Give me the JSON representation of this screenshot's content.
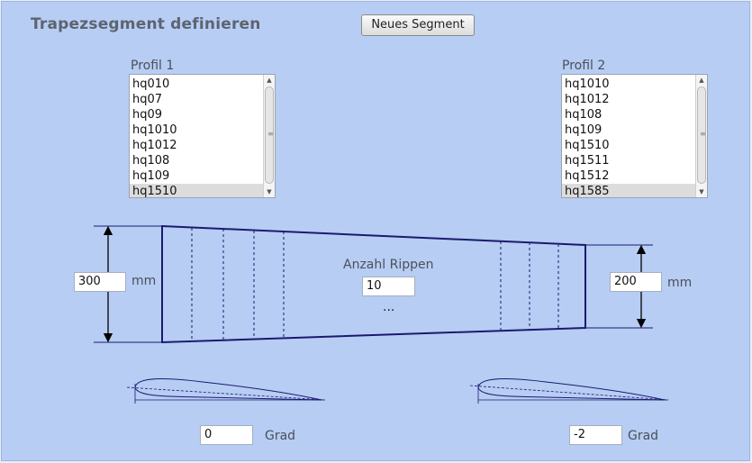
{
  "header": {
    "title": "Trapezsegment definieren",
    "new_segment_button": "Neues Segment"
  },
  "profile1": {
    "label": "Profil 1",
    "items": [
      "hq010",
      "hq07",
      "hq09",
      "hq1010",
      "hq1012",
      "hq108",
      "hq109",
      "hq1510"
    ],
    "selected": "hq1510"
  },
  "profile2": {
    "label": "Profil 2",
    "items": [
      "hq1010",
      "hq1012",
      "hq108",
      "hq109",
      "hq1510",
      "hq1511",
      "hq1512",
      "hq1585"
    ],
    "selected": "hq1585"
  },
  "left_chord": {
    "value": "300",
    "unit": "mm"
  },
  "right_chord": {
    "value": "200",
    "unit": "mm"
  },
  "ribs": {
    "label": "Anzahl Rippen",
    "value": "10",
    "ellipsis": "..."
  },
  "left_angle": {
    "value": "0",
    "unit": "Grad"
  },
  "right_angle": {
    "value": "-2",
    "unit": "Grad"
  },
  "colors": {
    "panel": "#b7cdf4",
    "outline": "#1a1a6e"
  }
}
